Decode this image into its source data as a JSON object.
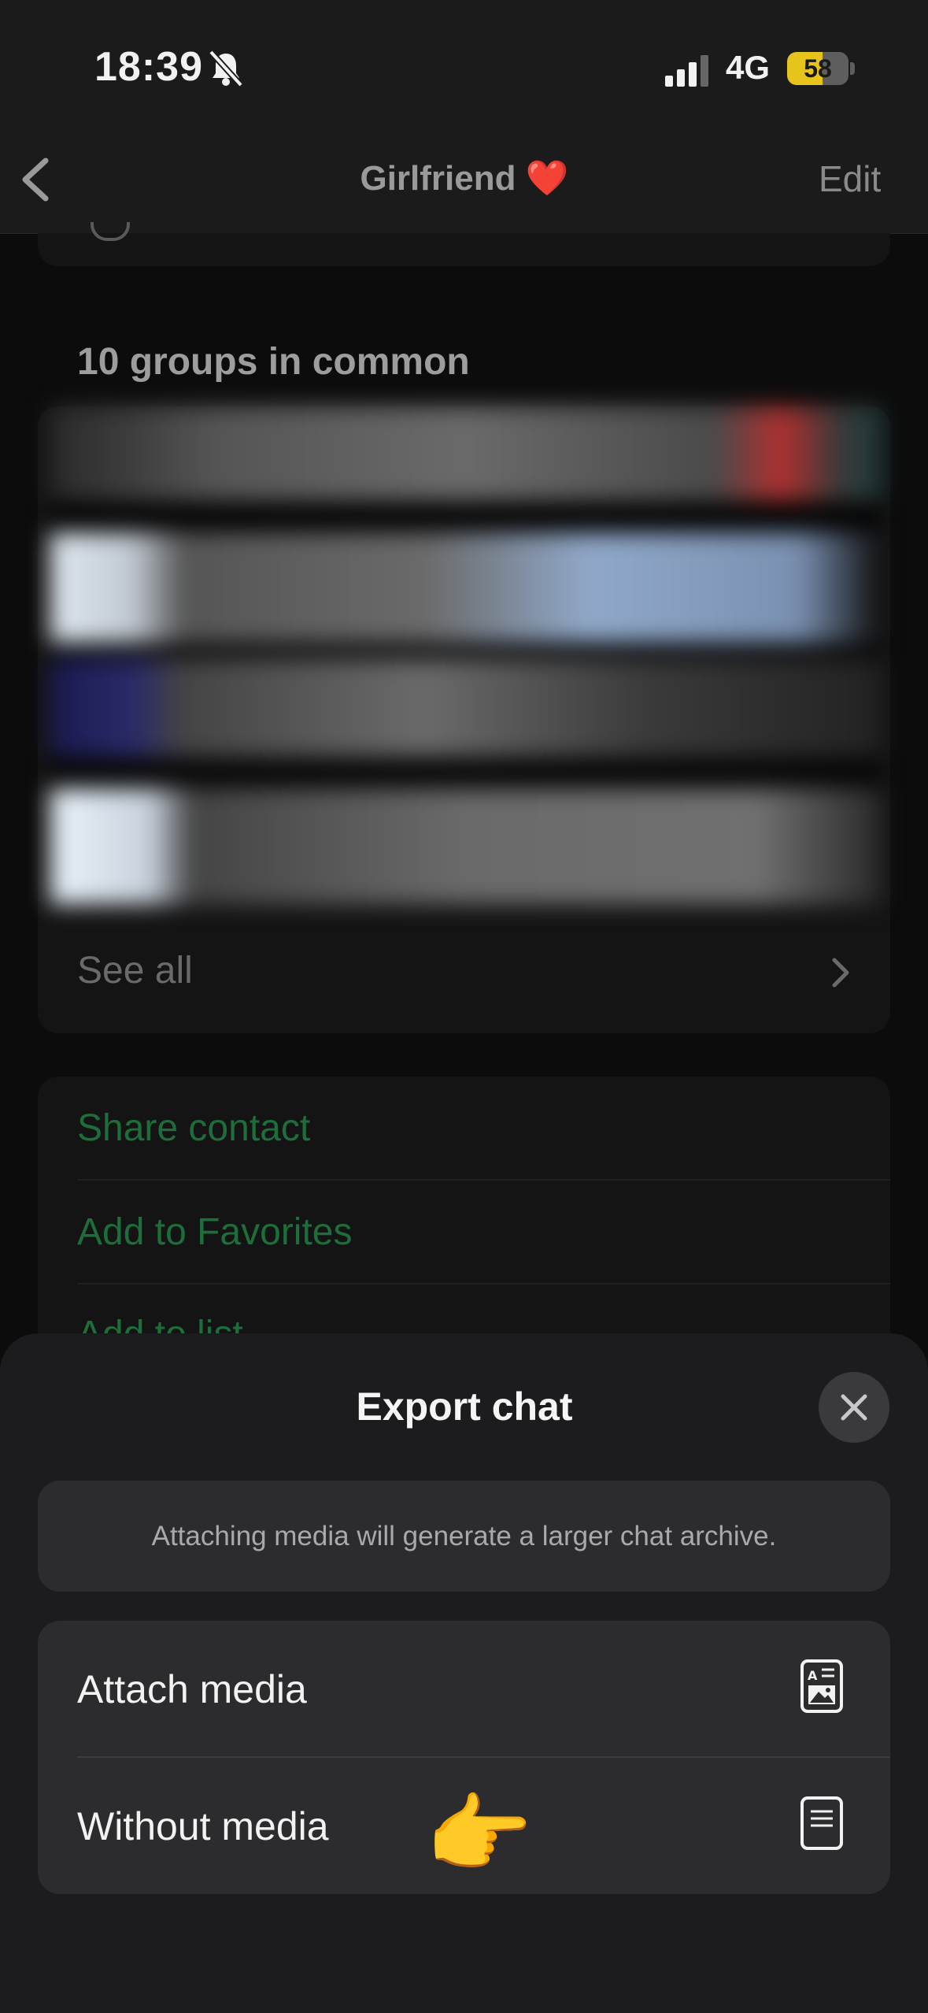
{
  "status_bar": {
    "time": "18:39",
    "network": "4G",
    "battery_level": 58,
    "battery_text": "58",
    "icons": [
      "bell-slash-icon",
      "signal-bars-icon",
      "battery-icon"
    ]
  },
  "nav": {
    "title": "Girlfriend ❤️",
    "edit_label": "Edit",
    "back_icon": "chevron-left-icon"
  },
  "groups": {
    "header": "10 groups in common",
    "see_all_label": "See all"
  },
  "actions": {
    "items": [
      {
        "label": "Share contact"
      },
      {
        "label": "Add to Favorites"
      },
      {
        "label": "Add to list"
      }
    ]
  },
  "export_sheet": {
    "title": "Export chat",
    "close_icon": "close-icon",
    "info": "Attaching media will generate a larger chat archive.",
    "options": [
      {
        "label": "Attach media",
        "icon": "document-with-image-icon"
      },
      {
        "label": "Without media",
        "icon": "document-icon"
      }
    ],
    "pointer": "👉"
  },
  "colors": {
    "accent_green": "#1d6e3a",
    "sheet_bg": "#1c1c1e",
    "card_bg": "#2c2c2e",
    "battery_yellow": "#e6c41c"
  }
}
